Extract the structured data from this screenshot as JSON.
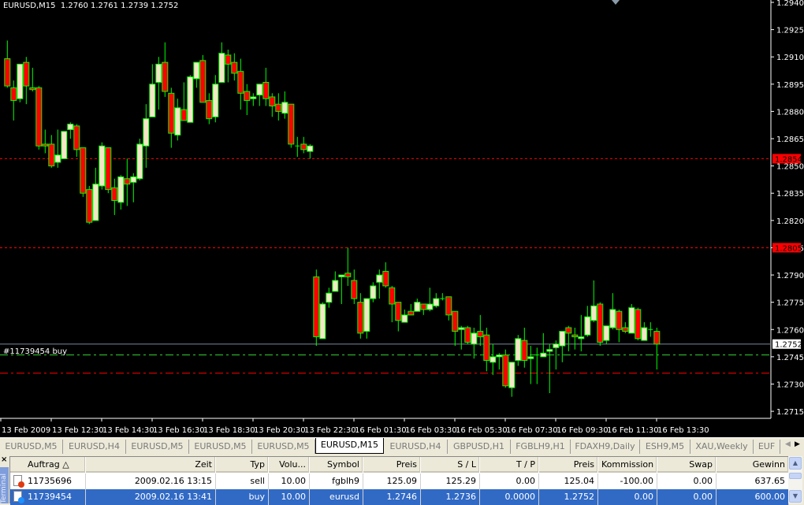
{
  "chart": {
    "header_symbol": "EURUSD,M15",
    "header_ohlc": "1.2760 1.2761 1.2739 1.2752",
    "order_label": "#11739454 buy",
    "bid_label": "1.2752",
    "line_labels": [
      "1.2854",
      "1.2805"
    ],
    "colors": {
      "bull_body": "#f5e6c8",
      "bear_body": "#ff0000",
      "outline": "#00ff00",
      "background": "#000000",
      "bid_line": "#778899",
      "level_line": "#ff0000",
      "entry_line": "#32cd32",
      "stoploss_line": "#ff0000"
    }
  },
  "chart_data": {
    "type": "candlestick",
    "symbol": "EURUSD",
    "timeframe": "M15",
    "ylim": [
      1.2715,
      1.294
    ],
    "y_ticks": [
      "1.2940",
      "1.2925",
      "1.2910",
      "1.2895",
      "1.2880",
      "1.2865",
      "1.2850",
      "1.2835",
      "1.2820",
      "1.2805",
      "1.2790",
      "1.2775",
      "1.2760",
      "1.2745",
      "1.2730",
      "1.2715"
    ],
    "x_ticks": [
      "13 Feb 2009",
      "13 Feb 12:30",
      "13 Feb 14:30",
      "13 Feb 16:30",
      "13 Feb 18:30",
      "13 Feb 20:30",
      "13 Feb 22:30",
      "16 Feb 01:30",
      "16 Feb 03:30",
      "16 Feb 05:30",
      "16 Feb 07:30",
      "16 Feb 09:30",
      "16 Feb 11:30",
      "16 Feb 13:30"
    ],
    "horizontal_lines": [
      {
        "price": 1.2854,
        "style": "dotted",
        "color": "#ff0000"
      },
      {
        "price": 1.2805,
        "style": "dotted",
        "color": "#ff0000"
      },
      {
        "price": 1.2752,
        "style": "solid",
        "color": "#778899"
      },
      {
        "price": 1.2746,
        "style": "dashdot",
        "color": "#32cd32"
      },
      {
        "price": 1.2736,
        "style": "dashdot",
        "color": "#ff0000"
      }
    ],
    "ohlc": [
      [
        1.2909,
        1.2919,
        1.2893,
        1.2894
      ],
      [
        1.2893,
        1.2897,
        1.2875,
        1.2886
      ],
      [
        1.2887,
        1.2906,
        1.2885,
        1.2906
      ],
      [
        1.2907,
        1.291,
        1.2884,
        1.2894
      ],
      [
        1.2893,
        1.2904,
        1.2891,
        1.2892
      ],
      [
        1.2893,
        1.2894,
        1.2859,
        1.2861
      ],
      [
        1.2862,
        1.287,
        1.2857,
        1.2861
      ],
      [
        1.2862,
        1.2867,
        1.2849,
        1.285
      ],
      [
        1.2852,
        1.287,
        1.2849,
        1.2856
      ],
      [
        1.2854,
        1.2869,
        1.2854,
        1.2869
      ],
      [
        1.287,
        1.2874,
        1.2865,
        1.2873
      ],
      [
        1.2872,
        1.2873,
        1.2855,
        1.2859
      ],
      [
        1.286,
        1.286,
        1.2833,
        1.2835
      ],
      [
        1.2837,
        1.2839,
        1.2818,
        1.2819
      ],
      [
        1.282,
        1.2849,
        1.282,
        1.284
      ],
      [
        1.2839,
        1.2863,
        1.2837,
        1.2861
      ],
      [
        1.286,
        1.286,
        1.2835,
        1.2837
      ],
      [
        1.2838,
        1.2843,
        1.2823,
        1.2831
      ],
      [
        1.283,
        1.2845,
        1.2826,
        1.2844
      ],
      [
        1.2843,
        1.2854,
        1.2828,
        1.284
      ],
      [
        1.2841,
        1.2846,
        1.283,
        1.2844
      ],
      [
        1.2843,
        1.2865,
        1.2842,
        1.2862
      ],
      [
        1.2861,
        1.2884,
        1.2849,
        1.2876
      ],
      [
        1.2877,
        1.2906,
        1.2877,
        1.2895
      ],
      [
        1.2896,
        1.291,
        1.2881,
        1.2906
      ],
      [
        1.2907,
        1.2918,
        1.2888,
        1.2891
      ],
      [
        1.289,
        1.2893,
        1.286,
        1.2868
      ],
      [
        1.2867,
        1.2887,
        1.2864,
        1.2882
      ],
      [
        1.2881,
        1.2896,
        1.2875,
        1.2875
      ],
      [
        1.2874,
        1.29,
        1.2874,
        1.2899
      ],
      [
        1.2898,
        1.2907,
        1.2893,
        1.2907
      ],
      [
        1.2908,
        1.2911,
        1.2885,
        1.2885
      ],
      [
        1.2886,
        1.289,
        1.2873,
        1.2876
      ],
      [
        1.2877,
        1.29,
        1.2874,
        1.2895
      ],
      [
        1.2896,
        1.2918,
        1.2896,
        1.2912
      ],
      [
        1.2911,
        1.2914,
        1.2896,
        1.2906
      ],
      [
        1.2907,
        1.2912,
        1.2897,
        1.2901
      ],
      [
        1.2902,
        1.2909,
        1.2881,
        1.289
      ],
      [
        1.2891,
        1.2895,
        1.2878,
        1.2886
      ],
      [
        1.2887,
        1.289,
        1.2883,
        1.2888
      ],
      [
        1.2889,
        1.2895,
        1.2883,
        1.2895
      ],
      [
        1.2896,
        1.2904,
        1.2883,
        1.2887
      ],
      [
        1.2888,
        1.289,
        1.2877,
        1.2883
      ],
      [
        1.2884,
        1.289,
        1.2875,
        1.288
      ],
      [
        1.2879,
        1.2891,
        1.2876,
        1.2885
      ],
      [
        1.2884,
        1.2884,
        1.286,
        1.2862
      ],
      [
        1.2861,
        1.2866,
        1.2855,
        1.2861
      ],
      [
        1.2862,
        1.2866,
        1.2857,
        1.2859
      ],
      [
        1.2858,
        1.2862,
        1.2854,
        1.2861
      ],
      [
        1.2789,
        1.2793,
        1.2751,
        1.2756
      ],
      [
        1.2755,
        1.2775,
        1.2755,
        1.2774
      ],
      [
        1.2775,
        1.2783,
        1.2772,
        1.278
      ],
      [
        1.2781,
        1.2792,
        1.2781,
        1.2787
      ],
      [
        1.2789,
        1.279,
        1.2774,
        1.279
      ],
      [
        1.2791,
        1.2805,
        1.2784,
        1.2789
      ],
      [
        1.2787,
        1.2793,
        1.2774,
        1.2777
      ],
      [
        1.2775,
        1.278,
        1.2755,
        1.2758
      ],
      [
        1.2759,
        1.2777,
        1.2755,
        1.2777
      ],
      [
        1.2777,
        1.2786,
        1.2775,
        1.2784
      ],
      [
        1.2786,
        1.2793,
        1.2777,
        1.279
      ],
      [
        1.2792,
        1.2797,
        1.2783,
        1.2784
      ],
      [
        1.2783,
        1.2784,
        1.2764,
        1.2774
      ],
      [
        1.2775,
        1.2775,
        1.2759,
        1.2765
      ],
      [
        1.2764,
        1.2771,
        1.2764,
        1.2768
      ],
      [
        1.277,
        1.2774,
        1.2768,
        1.2768
      ],
      [
        1.277,
        1.2777,
        1.277,
        1.2775
      ],
      [
        1.2774,
        1.2774,
        1.2768,
        1.2771
      ],
      [
        1.2771,
        1.2783,
        1.277,
        1.2774
      ],
      [
        1.2773,
        1.278,
        1.2772,
        1.2777
      ],
      [
        1.2777,
        1.278,
        1.2776,
        1.2777
      ],
      [
        1.2778,
        1.2778,
        1.2765,
        1.2768
      ],
      [
        1.277,
        1.277,
        1.2751,
        1.2759
      ],
      [
        1.276,
        1.2762,
        1.2749,
        1.2761
      ],
      [
        1.2761,
        1.2762,
        1.2752,
        1.2753
      ],
      [
        1.2752,
        1.2761,
        1.2744,
        1.2758
      ],
      [
        1.2759,
        1.2768,
        1.2751,
        1.2756
      ],
      [
        1.2757,
        1.2761,
        1.2737,
        1.2743
      ],
      [
        1.2742,
        1.2752,
        1.2735,
        1.2745
      ],
      [
        1.2745,
        1.2747,
        1.2738,
        1.2746
      ],
      [
        1.2746,
        1.2749,
        1.2728,
        1.2729
      ],
      [
        1.2728,
        1.2742,
        1.2723,
        1.2742
      ],
      [
        1.2743,
        1.2757,
        1.274,
        1.2755
      ],
      [
        1.2754,
        1.2761,
        1.2739,
        1.2743
      ],
      [
        1.2744,
        1.2751,
        1.273,
        1.2745
      ],
      [
        1.2746,
        1.275,
        1.273,
        1.2746
      ],
      [
        1.2745,
        1.2758,
        1.2745,
        1.2747
      ],
      [
        1.2748,
        1.2752,
        1.2725,
        1.2749
      ],
      [
        1.275,
        1.2754,
        1.2738,
        1.2752
      ],
      [
        1.2751,
        1.2759,
        1.2742,
        1.2759
      ],
      [
        1.2761,
        1.2762,
        1.2748,
        1.2758
      ],
      [
        1.2757,
        1.2761,
        1.2749,
        1.2756
      ],
      [
        1.2755,
        1.2768,
        1.2748,
        1.2756
      ],
      [
        1.2757,
        1.2773,
        1.2756,
        1.2767
      ],
      [
        1.2765,
        1.2787,
        1.2764,
        1.2773
      ],
      [
        1.2774,
        1.2775,
        1.2751,
        1.2753
      ],
      [
        1.2754,
        1.2762,
        1.2752,
        1.2762
      ],
      [
        1.2761,
        1.278,
        1.276,
        1.2771
      ],
      [
        1.277,
        1.2771,
        1.2753,
        1.276
      ],
      [
        1.2761,
        1.2764,
        1.2758,
        1.2759
      ],
      [
        1.2758,
        1.2774,
        1.2758,
        1.2772
      ],
      [
        1.2771,
        1.2772,
        1.2754,
        1.2755
      ],
      [
        1.2754,
        1.2764,
        1.2754,
        1.2761
      ],
      [
        1.276,
        1.2764,
        1.2756,
        1.276
      ],
      [
        1.2759,
        1.2761,
        1.2738,
        1.2752
      ]
    ]
  },
  "tabs": [
    {
      "label": "EURUSD,M5"
    },
    {
      "label": "EURUSD,H4"
    },
    {
      "label": "EURUSD,M5"
    },
    {
      "label": "EURUSD,M5"
    },
    {
      "label": "EURUSD,M5"
    },
    {
      "label": "EURUSD,M15",
      "active": true
    },
    {
      "label": "EURUSD,H4"
    },
    {
      "label": "GBPUSD,H1"
    },
    {
      "label": "FGBLH9,H1"
    },
    {
      "label": "FDAXH9,Daily"
    },
    {
      "label": "ESH9,M5"
    },
    {
      "label": "XAU,Weekly"
    },
    {
      "label": "EUF"
    }
  ],
  "terminal": {
    "close_label": "×",
    "side_label": "Terminal",
    "columns": [
      "Auftrag  △",
      "Zeit",
      "Typ",
      "Volu...",
      "Symbol",
      "Preis",
      "S / L",
      "T / P",
      "Preis",
      "Kommission",
      "Swap",
      "Gewinn"
    ],
    "rows": [
      {
        "icon": "sell-order-icon",
        "icon_color": "#e03a10",
        "cells": [
          "11735696",
          "2009.02.16 13:15",
          "sell",
          "10.00",
          "fgblh9",
          "125.09",
          "125.29",
          "0.00",
          "125.04",
          "-100.00",
          "0.00",
          "637.65"
        ]
      },
      {
        "icon": "buy-order-icon",
        "icon_color": "#1e90ff",
        "selected": true,
        "cells": [
          "11739454",
          "2009.02.16 13:41",
          "buy",
          "10.00",
          "eurusd",
          "1.2746",
          "1.2736",
          "0.0000",
          "1.2752",
          "0.00",
          "0.00",
          "600.00"
        ]
      }
    ]
  }
}
